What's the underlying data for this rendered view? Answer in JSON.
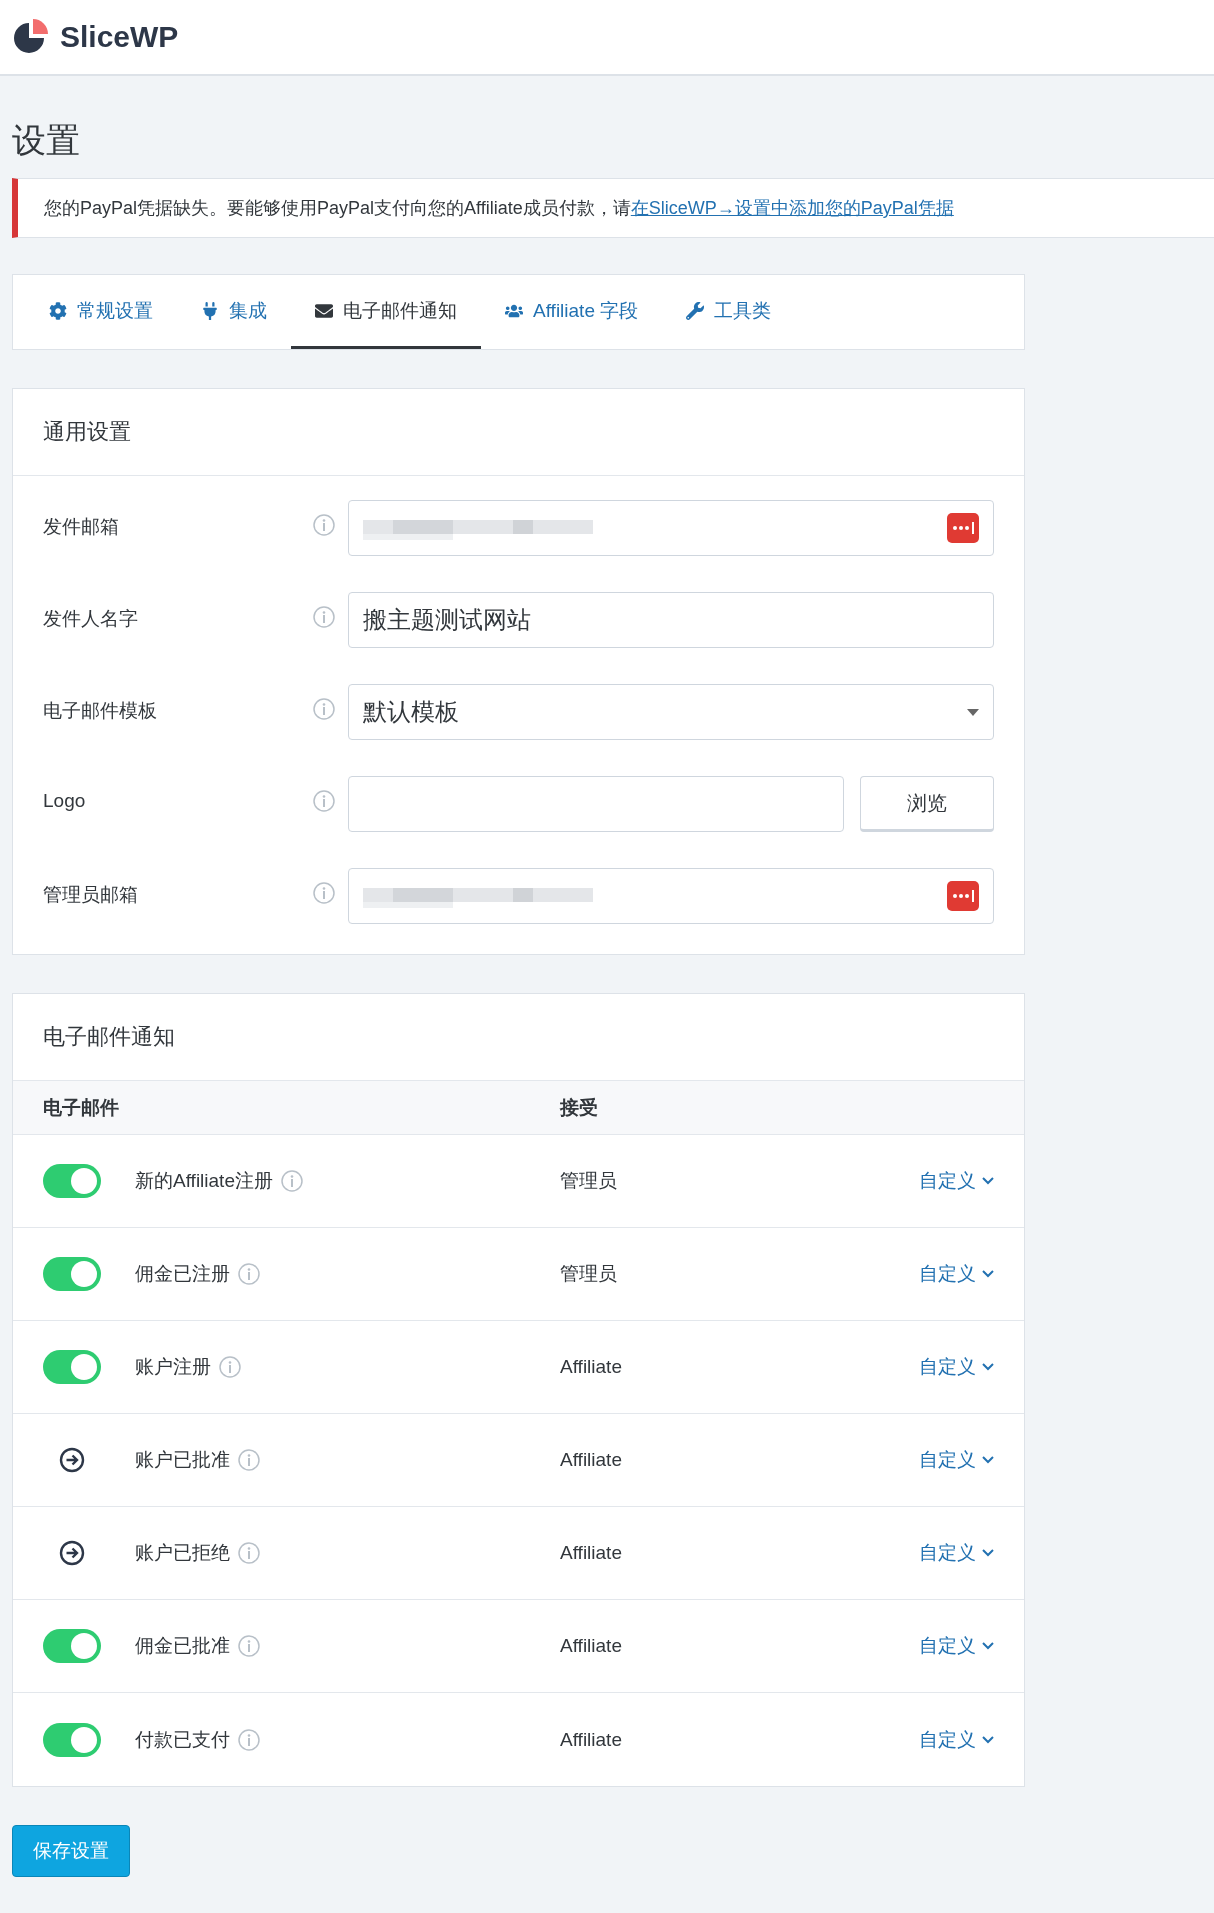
{
  "header": {
    "brand": "SliceWP"
  },
  "page_title": "设置",
  "notice": {
    "text": "您的PayPal凭据缺失。要能够使用PayPal支付向您的Affiliate成员付款，请",
    "link": "在SliceWP→设置中添加您的PayPal凭据"
  },
  "tabs": [
    {
      "label": "常规设置",
      "kind": "gear",
      "selected": false
    },
    {
      "label": "集成",
      "kind": "plug",
      "selected": false
    },
    {
      "label": "电子邮件通知",
      "kind": "envelope",
      "selected": true
    },
    {
      "label": "Affiliate 字段",
      "kind": "users",
      "selected": false
    },
    {
      "label": "工具类",
      "kind": "wrench",
      "selected": false
    }
  ],
  "general_settings": {
    "title": "通用设置",
    "fields": [
      {
        "label": "发件邮箱",
        "kind": "email"
      },
      {
        "label": "发件人名字",
        "kind": "text",
        "value": "搬主题测试网站"
      },
      {
        "label": "电子邮件模板",
        "kind": "select",
        "value": "默认模板"
      },
      {
        "label": "Logo",
        "kind": "file",
        "button": "浏览"
      },
      {
        "label": "管理员邮箱",
        "kind": "email"
      }
    ]
  },
  "notifications": {
    "title": "电子邮件通知",
    "columns": [
      "电子邮件",
      "接受"
    ],
    "rows": [
      {
        "kind": "toggle",
        "on": true,
        "name": "新的Affiliate注册",
        "recipient": "管理员",
        "action": "自定义"
      },
      {
        "kind": "toggle",
        "on": true,
        "name": "佣金已注册",
        "recipient": "管理员",
        "action": "自定义"
      },
      {
        "kind": "toggle",
        "on": true,
        "name": "账户注册",
        "recipient": "Affiliate",
        "action": "自定义"
      },
      {
        "kind": "arrow",
        "name": "账户已批准",
        "recipient": "Affiliate",
        "action": "自定义"
      },
      {
        "kind": "arrow",
        "name": "账户已拒绝",
        "recipient": "Affiliate",
        "action": "自定义"
      },
      {
        "kind": "toggle",
        "on": true,
        "name": "佣金已批准",
        "recipient": "Affiliate",
        "action": "自定义"
      },
      {
        "kind": "toggle",
        "on": true,
        "name": "付款已支付",
        "recipient": "Affiliate",
        "action": "自定义"
      }
    ]
  },
  "save_button": "保存设置"
}
